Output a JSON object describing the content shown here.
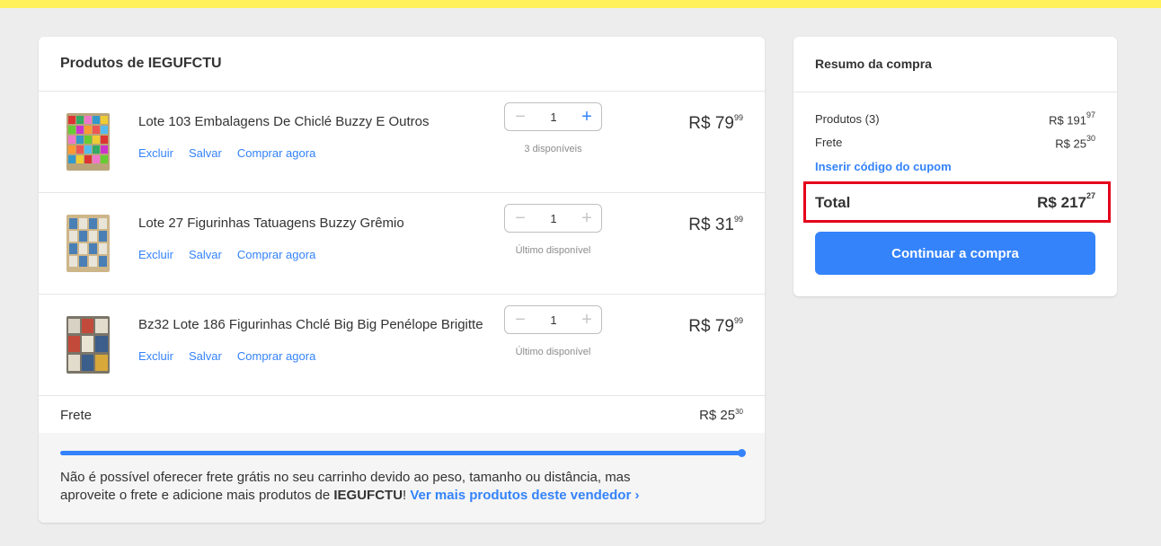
{
  "cart": {
    "heading": "Produtos de IEGUFCTU",
    "items": [
      {
        "title": "Lote 103 Embalagens De Chiclé Buzzy E Outros",
        "actions": [
          "Excluir",
          "Salvar",
          "Comprar agora"
        ],
        "quantity": "1",
        "availability": "3 disponíveis",
        "price_int": "R$ 79",
        "price_cents": "99",
        "plus_enabled": true
      },
      {
        "title": "Lote 27 Figurinhas Tatuagens Buzzy Grêmio",
        "actions": [
          "Excluir",
          "Salvar",
          "Comprar agora"
        ],
        "quantity": "1",
        "availability": "Último disponível",
        "price_int": "R$ 31",
        "price_cents": "99",
        "plus_enabled": false
      },
      {
        "title": "Bz32 Lote 186 Figurinhas Chclé Big Big Penélope Brigitte",
        "actions": [
          "Excluir",
          "Salvar",
          "Comprar agora"
        ],
        "quantity": "1",
        "availability": "Último disponível",
        "price_int": "R$ 79",
        "price_cents": "99",
        "plus_enabled": false
      }
    ],
    "freight_label": "Frete",
    "freight_int": "R$ 25",
    "freight_cents": "30",
    "shipping_progress": 1.0,
    "shipping_msg_pre": "Não é possível oferecer frete grátis no seu carrinho devido ao peso, tamanho ou distância, mas aproveite o frete e adicione mais produtos de ",
    "shipping_msg_seller": "IEGUFCTU",
    "shipping_msg_bang": "!",
    "shipping_msg_link": "Ver mais produtos deste vendedor ›"
  },
  "summary": {
    "heading": "Resumo da compra",
    "products_label": "Produtos (3)",
    "products_int": "R$ 191",
    "products_cents": "97",
    "freight_label": "Frete",
    "freight_int": "R$ 25",
    "freight_cents": "30",
    "coupon_link": "Inserir código do cupom",
    "total_label": "Total",
    "total_int": "R$ 217",
    "total_cents": "27",
    "cta_label": "Continuar a compra"
  },
  "colors": {
    "brand_yellow": "#fff159",
    "accent_blue": "#3483fa",
    "highlight_red": "#e5001b"
  }
}
